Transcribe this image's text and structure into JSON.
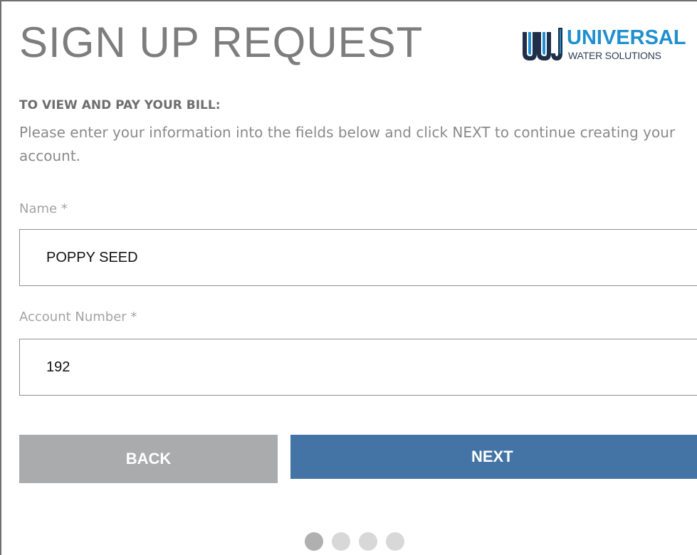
{
  "page": {
    "title": "SIGN UP REQUEST"
  },
  "logo": {
    "word": "UNIVERSAL",
    "tagline": "WATER SOLUTIONS",
    "colors": {
      "primary": "#1f8fd0",
      "dark": "#2c3e55"
    }
  },
  "intro": {
    "heading": "TO VIEW AND PAY YOUR BILL:",
    "text": "Please enter your information into the fields below and click NEXT to continue creating your account."
  },
  "form": {
    "name": {
      "label": "Name *",
      "value": "POPPY SEED"
    },
    "account_number": {
      "label": "Account Number *",
      "value": "192"
    }
  },
  "buttons": {
    "back_label": "BACK",
    "next_label": "NEXT",
    "back_color": "#a9abad",
    "next_color": "#4374a5"
  },
  "progress": {
    "total_steps": 4,
    "current_step": 1
  }
}
